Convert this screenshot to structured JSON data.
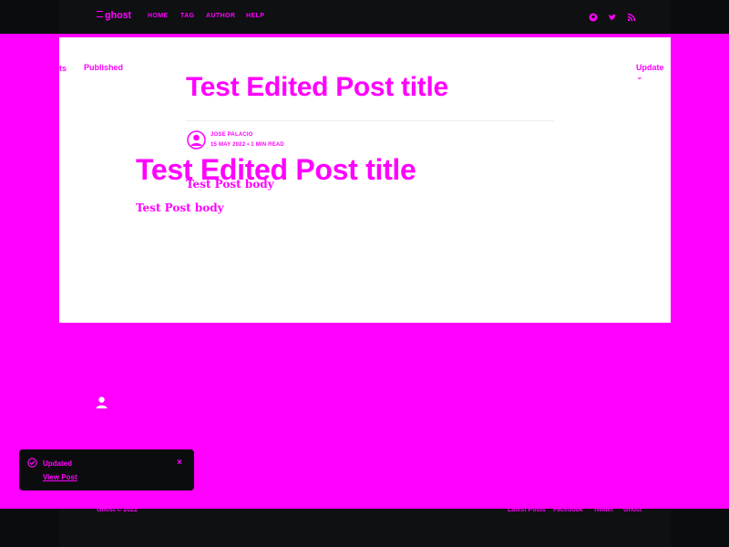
{
  "header": {
    "logo_text": "ghost",
    "nav": [
      "HOME",
      "TAG",
      "AUTHOR",
      "HELP"
    ],
    "social_icons": [
      "github-icon",
      "twitter-icon",
      "rss-icon"
    ]
  },
  "editor": {
    "breadcrumb": "ts",
    "status": "Published",
    "update_label": "Update"
  },
  "post": {
    "title": "Test Edited Post title",
    "author": "JOSE PALACIO",
    "date": "15 MAY 2022",
    "separator": "•",
    "read_time": "1 MIN READ",
    "body": "Test Post body"
  },
  "footer": {
    "copyright": "Ghost © 2022",
    "links": [
      "Latest Posts",
      "Facebook",
      "Twitter",
      "Ghost"
    ]
  },
  "toast": {
    "title": "Updated",
    "link": "View Post",
    "close": "×"
  },
  "colors": {
    "accent": "#ff00ff",
    "dark": "#0b0c0d",
    "surface": "#ffffff"
  }
}
